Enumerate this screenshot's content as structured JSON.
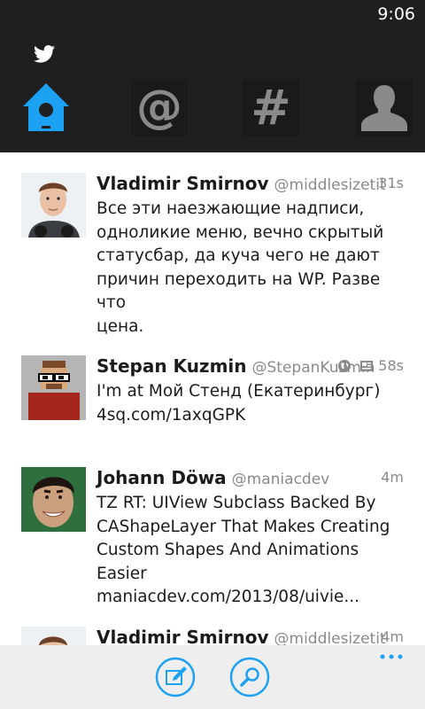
{
  "status": {
    "time": "9:06"
  },
  "app": {
    "logo_icon": "twitter-bird-icon",
    "accent": "#1da1f2"
  },
  "tabs": [
    {
      "icon": "home-birdhouse-icon",
      "active": true
    },
    {
      "icon": "at-sign-icon",
      "active": false
    },
    {
      "icon": "hashtag-icon",
      "active": false
    },
    {
      "icon": "person-icon",
      "active": false
    }
  ],
  "tweets": [
    {
      "name": "Vladimir Smirnov",
      "handle": "@middlesizetit",
      "time": "31s",
      "lines": [
        "Все эти наезжающие надписи,",
        "одноликие меню, вечно скрытый",
        "статусбар, да куча чего не дают",
        "причин переходить на WP. Разве что",
        "цена."
      ]
    },
    {
      "name": "Stepan Kuzmin",
      "handle": "@StepanKuzmin",
      "time": "58s",
      "meta_icons": [
        "globe-icon",
        "document-icon"
      ],
      "lines": [
        "I'm at Мой Стенд (Екатеринбург)",
        "4sq.com/1axqGPK"
      ]
    },
    {
      "name": "Johann Döwa",
      "handle": "@maniacdev",
      "time": "4m",
      "lines": [
        "TZ RT: UIView Subclass Backed By",
        "CAShapeLayer That Makes Creating",
        "Custom Shapes And Animations Easier",
        "maniacdev.com/2013/08/uivie..."
      ]
    },
    {
      "name": "Vladimir Smirnov",
      "handle": "@middlesizetit",
      "time": "4m",
      "lines": []
    }
  ],
  "appbar": {
    "compose_icon": "compose-icon",
    "search_icon": "search-icon",
    "more_icon": "more-ellipsis-icon"
  }
}
